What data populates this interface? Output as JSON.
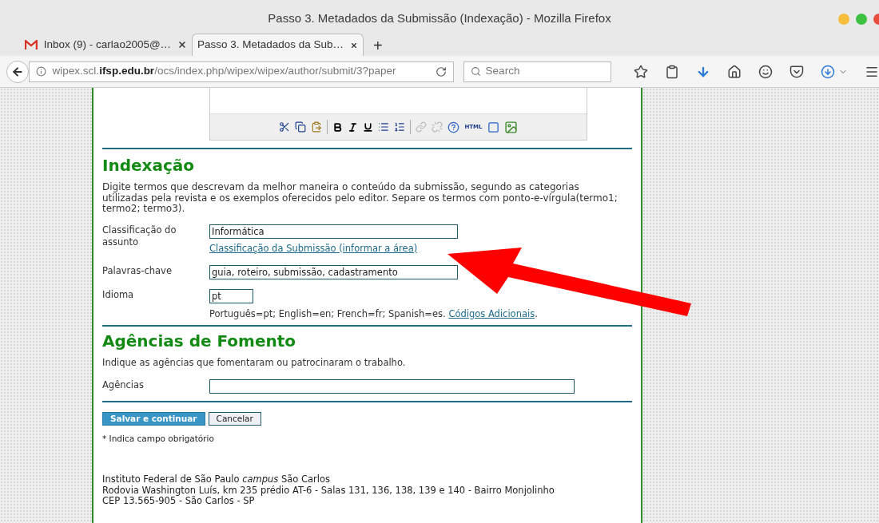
{
  "window": {
    "title": "Passo 3. Metadados da Submissão (Indexação) - Mozilla Firefox"
  },
  "tabs": [
    {
      "label": "Inbox (9) - carlao2005@…",
      "selected": false,
      "kind": "mail"
    },
    {
      "label": "Passo 3. Metadados da Sub…",
      "selected": true,
      "kind": "page"
    }
  ],
  "new_tab": "+",
  "address": {
    "url": "wipex.scl.**ifsp.edu.br**/ocs/index.php/wipex/wipex/author/submit/3?paper"
  },
  "search": {
    "placeholder": "Search"
  },
  "editor_toolbar": {
    "html_label": "HTML"
  },
  "indexacao": {
    "heading": "Indexação",
    "intro": "Digite termos que descrevam da melhor maneira o conteúdo da submissão, segundo as categorias utilizadas pela revista e os exemplos oferecidos pelo editor. Separe os termos com ponto-e-vírgula(termo1; termo2; termo3).",
    "fields": [
      {
        "label": "Classificação do assunto",
        "value": "Informática",
        "kind": "normal",
        "link": "Classificação da Submissão (informar a área)"
      },
      {
        "label": "Palavras-chave",
        "value": "guia, roteiro, submissão, cadastramento",
        "kind": "normal"
      },
      {
        "label": "Idioma",
        "value": "pt",
        "kind": "short",
        "hint": "Português=pt; English=en; French=fr; Spanish=es.",
        "link": "Códigos Adicionais",
        "link_after": "."
      }
    ]
  },
  "agencias": {
    "heading": "Agências de Fomento",
    "intro": "Indique as agências que fomentaram ou patrocinaram o trabalho.",
    "fields": [
      {
        "label": "Agências",
        "kind": "wide"
      }
    ]
  },
  "buttons": [
    {
      "label": "Salvar e continuar",
      "kind": "primary"
    },
    {
      "label": "Cancelar",
      "kind": "secondary"
    }
  ],
  "required_note": "* Indica campo obrigatório",
  "footer": [
    "Instituto Federal de São Paulo *campus* São Carlos",
    "Rodovia Washington Luís, km 235 prédio AT-6 - Salas 131, 136, 138, 139 e 140 - Bairro Monjolinho",
    "CEP 13.565-905 - São Carlos - SP"
  ]
}
